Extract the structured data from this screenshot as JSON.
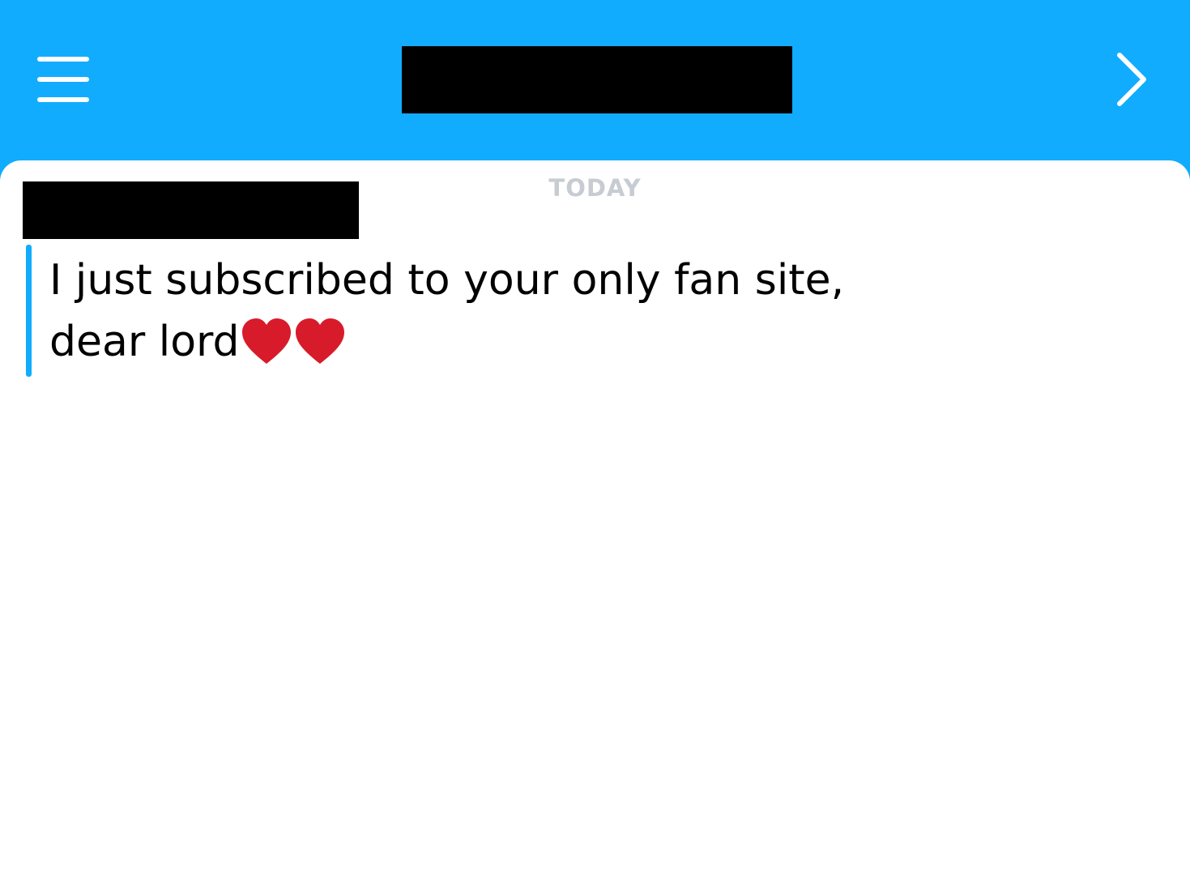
{
  "header": {
    "menu_icon": "hamburger-menu-icon",
    "title": "",
    "forward_icon": "chevron-right-icon"
  },
  "chat": {
    "date_divider": "TODAY",
    "sender_name": "",
    "message": {
      "line1": "I just subscribed to your only fan site,",
      "line2": "dear lord",
      "emojis": [
        "heart-icon",
        "heart-icon"
      ]
    }
  },
  "colors": {
    "accent": "#12ACFE",
    "divider_text": "#C7CCD3",
    "heart": "#D81B2A"
  }
}
